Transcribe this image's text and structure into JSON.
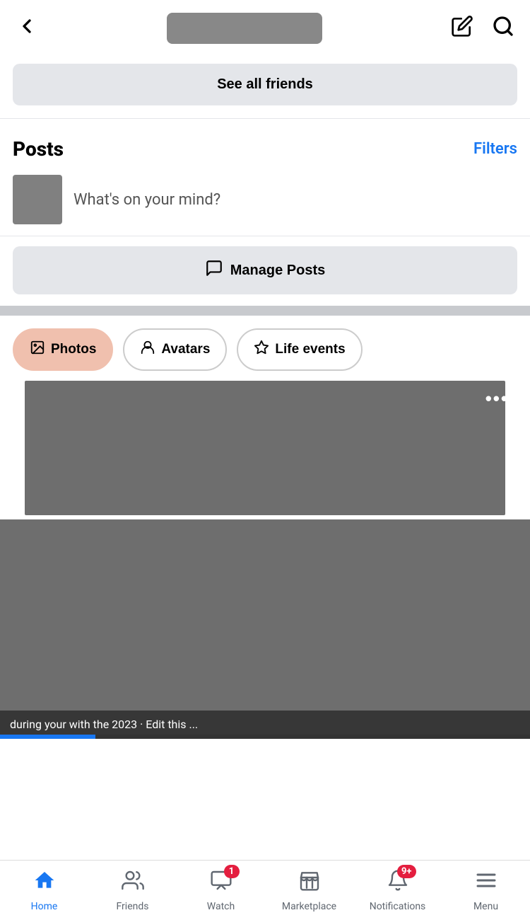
{
  "topbar": {
    "back_label": "‹",
    "edit_icon": "✏",
    "search_icon": "🔍"
  },
  "buttons": {
    "see_all_friends": "See all friends",
    "filters": "Filters",
    "whats_on_mind": "What's on your mind?",
    "manage_posts": "Manage Posts"
  },
  "sections": {
    "posts_title": "Posts"
  },
  "tabs": [
    {
      "id": "photos",
      "label": "Photos",
      "active": true
    },
    {
      "id": "avatars",
      "label": "Avatars",
      "active": false
    },
    {
      "id": "life_events",
      "label": "Life events",
      "active": false
    }
  ],
  "bottom_nav": [
    {
      "id": "home",
      "label": "Home",
      "active": true,
      "badge": null
    },
    {
      "id": "friends",
      "label": "Friends",
      "active": false,
      "badge": null
    },
    {
      "id": "watch",
      "label": "Watch",
      "active": false,
      "badge": "1"
    },
    {
      "id": "marketplace",
      "label": "Marketplace",
      "active": false,
      "badge": null
    },
    {
      "id": "notifications",
      "label": "Notifications",
      "active": false,
      "badge": "9+"
    },
    {
      "id": "menu",
      "label": "Menu",
      "active": false,
      "badge": null
    }
  ],
  "colors": {
    "active_tab_bg": "#f0c0ae",
    "facebook_blue": "#1877f2",
    "badge_red": "#e41e3f"
  }
}
